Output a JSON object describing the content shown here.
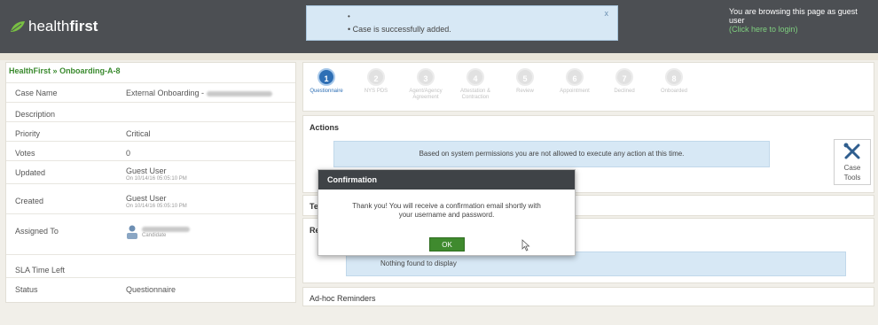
{
  "header": {
    "logo_text_light": "health",
    "logo_text_bold": "first",
    "toast": {
      "bullet": "•",
      "message": "•  Case is successfully added.",
      "close": "x"
    },
    "guest_notice": "You are browsing this page as guest user",
    "login_link": "(Click here to login)"
  },
  "breadcrumb": {
    "root": "HealthFirst",
    "separator": "»",
    "current": "Onboarding-A-8"
  },
  "case_details": {
    "case_name_label": "Case Name",
    "case_name_value": "External Onboarding - ",
    "description_label": "Description",
    "priority_label": "Priority",
    "priority_value": "Critical",
    "votes_label": "Votes",
    "votes_value": "0",
    "updated_label": "Updated",
    "updated_by": "Guest User",
    "updated_on": "On 10/14/16 05:05:10 PM",
    "created_label": "Created",
    "created_by": "Guest User",
    "created_on": "On 10/14/16 05:05:10 PM",
    "assigned_label": "Assigned To",
    "assigned_role": "Candidate",
    "sla_label": "SLA Time Left",
    "status_label": "Status",
    "status_value": "Questionnaire"
  },
  "steps": [
    {
      "num": "1",
      "label": "Questionnaire"
    },
    {
      "num": "2",
      "label": "NYS PDS"
    },
    {
      "num": "3",
      "label": "Agent/Agency Agreement"
    },
    {
      "num": "4",
      "label": "Attestation & Contraction"
    },
    {
      "num": "5",
      "label": "Review"
    },
    {
      "num": "6",
      "label": "Appointment"
    },
    {
      "num": "7",
      "label": "Declined"
    },
    {
      "num": "8",
      "label": "Onboarded"
    }
  ],
  "actions": {
    "title": "Actions",
    "message": "Based on system permissions you are not allowed to execute any action at this time."
  },
  "case_tools": {
    "line1": "Case",
    "line2": "Tools"
  },
  "tasks_title_partial": "Te",
  "reminders": {
    "title_partial": "Re",
    "empty": "Nothing found to display"
  },
  "adhoc_title": "Ad-hoc Reminders",
  "modal": {
    "title": "Confirmation",
    "line1": "Thank you! You will receive a confirmation email shortly with",
    "line2": "your username and password.",
    "ok_label": "OK"
  }
}
